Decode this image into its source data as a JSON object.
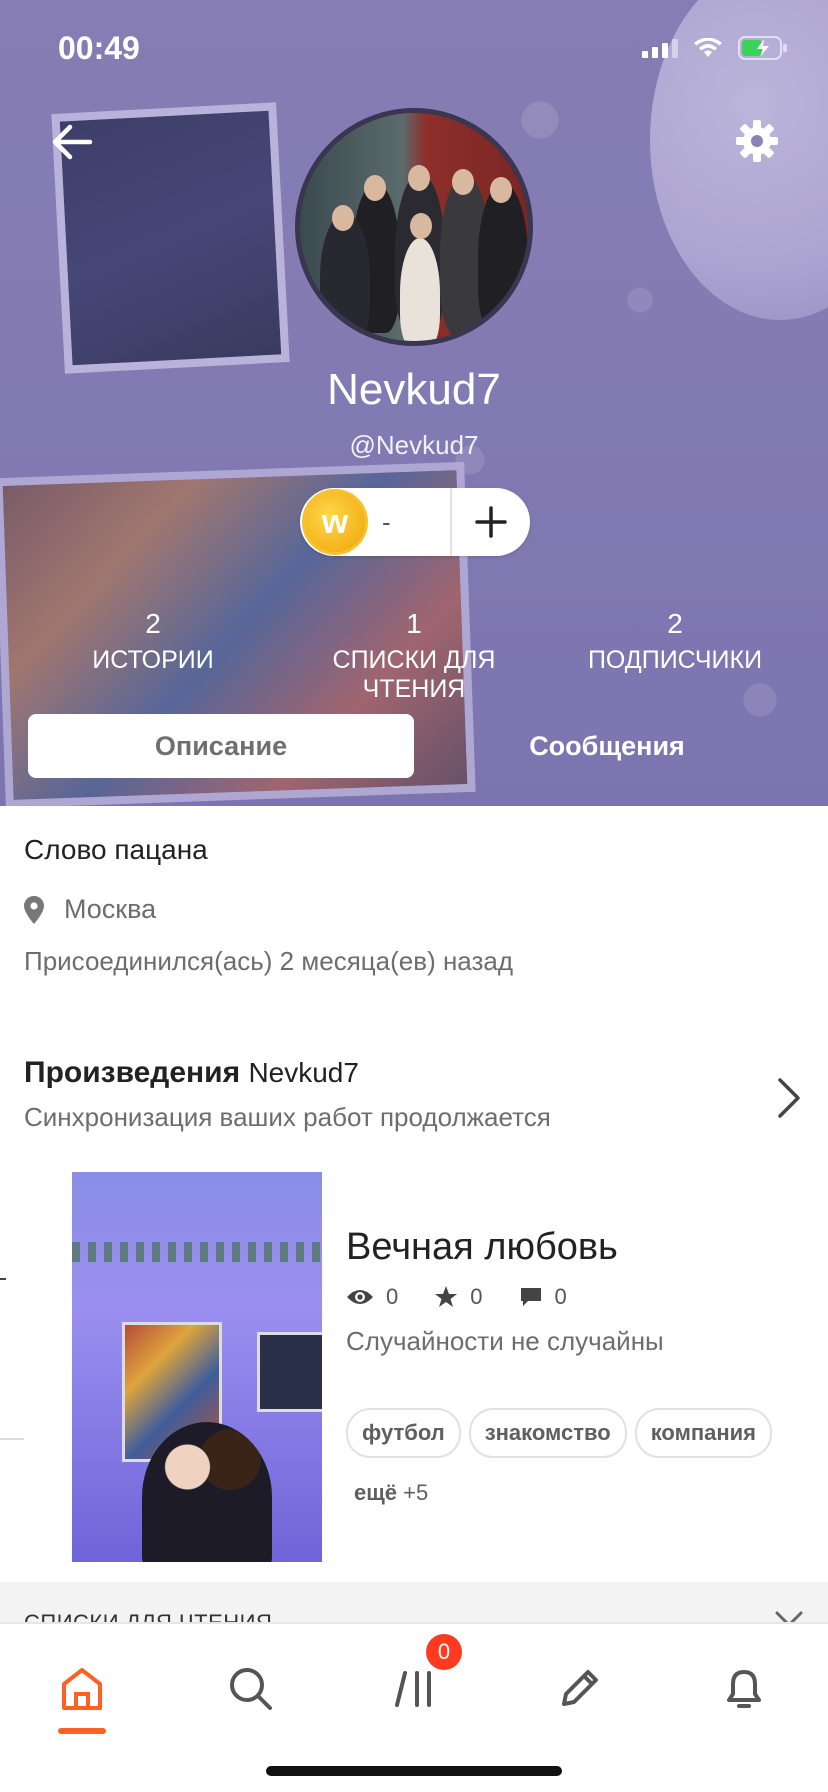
{
  "status_bar": {
    "time": "00:49"
  },
  "profile": {
    "display_name": "Nevkud7",
    "handle": "@Nevkud7",
    "coins": "-"
  },
  "stats": [
    {
      "value": "2",
      "label": "ИСТОРИИ"
    },
    {
      "value": "1",
      "label": "СПИСКИ ДЛЯ ЧТЕНИЯ"
    },
    {
      "value": "2",
      "label": "ПОДПИСЧИКИ"
    }
  ],
  "tabs": {
    "description": "Описание",
    "messages": "Сообщения"
  },
  "about": {
    "bio": "Слово пацана",
    "location": "Москва",
    "joined": "Присоединился(ась) 2 месяца(ев) назад"
  },
  "works": {
    "title": "Произведения",
    "author": "Nevkud7",
    "subtitle": "Синхронизация ваших работ продолжается"
  },
  "story": {
    "title": "Вечная любовь",
    "views": "0",
    "votes": "0",
    "comments": "0",
    "description": "Случайности не случайны",
    "tags": [
      "футбол",
      "знакомство",
      "компания"
    ],
    "more_label": "ещё",
    "more_count": "+5"
  },
  "reading_lists": {
    "label": "СПИСКИ ДЛЯ ЧТЕНИЯ"
  },
  "tabbar": {
    "library_badge": "0"
  },
  "colors": {
    "accent": "#ff6122",
    "badge": "#ff3b1f",
    "header_purple": "#8a83b3"
  }
}
